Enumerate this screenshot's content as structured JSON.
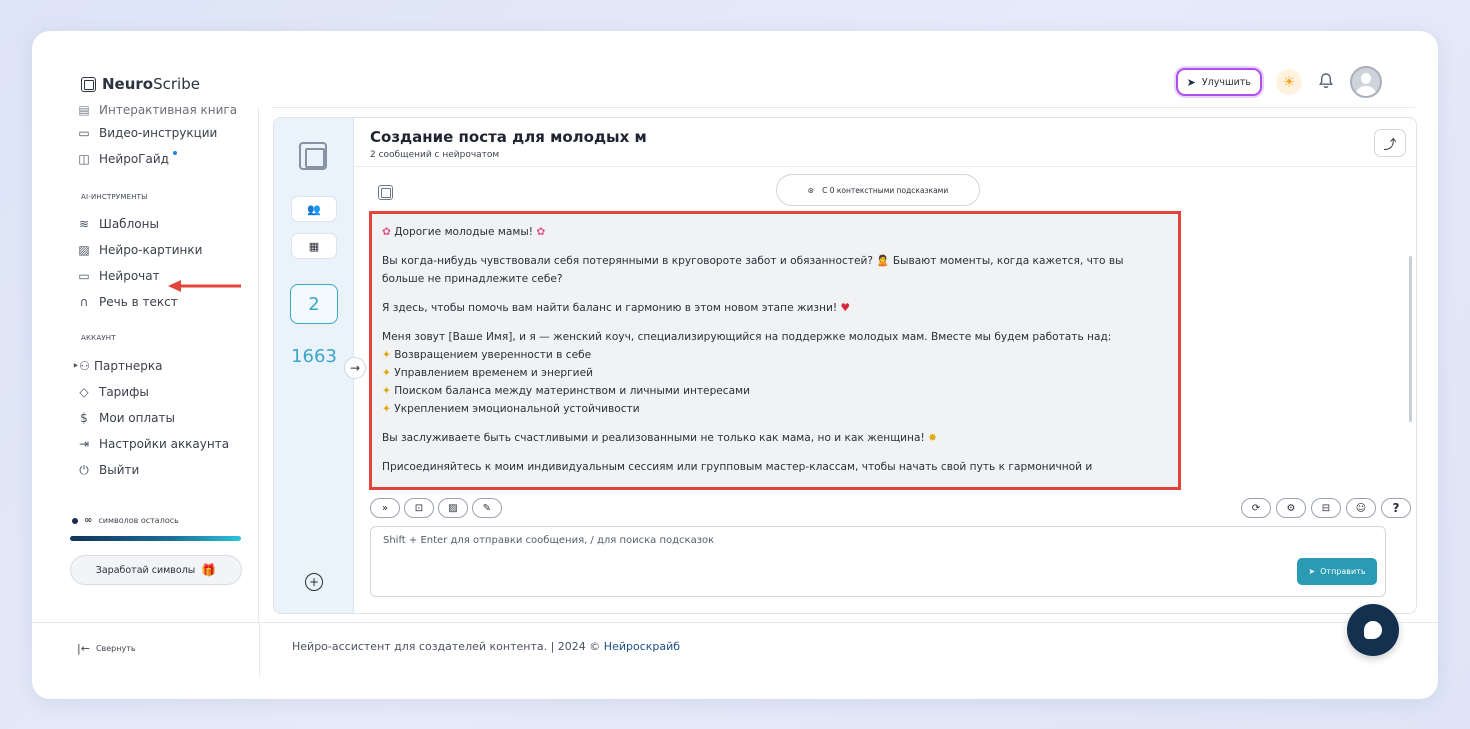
{
  "brand": {
    "part1": "Neuro",
    "part2": "Scribe"
  },
  "header": {
    "upgrade_label": "Улучшить"
  },
  "sidebar": {
    "items_top": [
      {
        "label": "Интерактивная книга",
        "icon": "book-icon"
      },
      {
        "label": "Видео-инструкции",
        "icon": "video-icon"
      },
      {
        "label": "НейроГайд",
        "icon": "guide-icon"
      }
    ],
    "section_ai": "AI-ИНСТРУМЕНТЫ",
    "items_ai": [
      {
        "label": "Шаблоны",
        "icon": "layers-icon"
      },
      {
        "label": "Нейро-картинки",
        "icon": "image-icon"
      },
      {
        "label": "Нейрочат",
        "icon": "chat-icon"
      },
      {
        "label": "Речь в текст",
        "icon": "headphones-icon"
      }
    ],
    "section_account": "АККАУНТ",
    "items_account": [
      {
        "label": "Партнерка",
        "icon": "users-icon"
      },
      {
        "label": "Тарифы",
        "icon": "tag-icon"
      },
      {
        "label": "Мои оплаты",
        "icon": "dollar-icon"
      },
      {
        "label": "Настройки аккаунта",
        "icon": "login-icon"
      },
      {
        "label": "Выйти",
        "icon": "power-icon"
      }
    ],
    "symbols": {
      "value": "∞",
      "label": "символов осталось",
      "fill_fraction": 1.0
    },
    "earn_label": "Заработай символы",
    "collapse_label": "Свернуть"
  },
  "rail": {
    "count_current": "2",
    "count_total": "1663"
  },
  "chat": {
    "title": "Создание поста для молодых м",
    "subtitle": "2 сообщений с нейрочатом",
    "context_pill": "С 0 контекстными подсказками",
    "message": {
      "greeting": "Дорогие молодые мамы!",
      "p1": "Вы когда-нибудь чувствовали себя потерянными в круговороте забот и обязанностей? 🙎 Бывают моменты, когда кажется, что вы больше не принадлежите себе?",
      "p2": "Я здесь, чтобы помочь вам найти баланс и гармонию в этом новом этапе жизни!",
      "p3_intro": "Меня зовут [Ваше Имя], и я — женский коуч, специализирующийся на поддержке молодых мам. Вместе мы будем работать над:",
      "bullets": [
        "Возвращением уверенности в себе",
        "Управлением временем и энергией",
        "Поиском баланса между материнством и личными интересами",
        "Укреплением эмоциональной устойчивости"
      ],
      "p4": "Вы заслуживаете быть счастливыми и реализованными не только как мама, но и как женщина!",
      "p5": "Присоединяйтесь к моим индивидуальным сессиям или групповым мастер-классам, чтобы начать свой путь к гармоничной и"
    },
    "input_placeholder": "Shift + Enter для отправки сообщения, / для поиска подсказок",
    "send_label": "Отправить"
  },
  "footer": {
    "text": "Нейро-ассистент для создателей контента.  | 2024 ©",
    "link": "Нейроскрайб"
  },
  "colors": {
    "accent": "#2a9bb2",
    "highlight_border": "#e2443c",
    "upgrade_border": "#b24df0",
    "dark_navy": "#13304f"
  }
}
